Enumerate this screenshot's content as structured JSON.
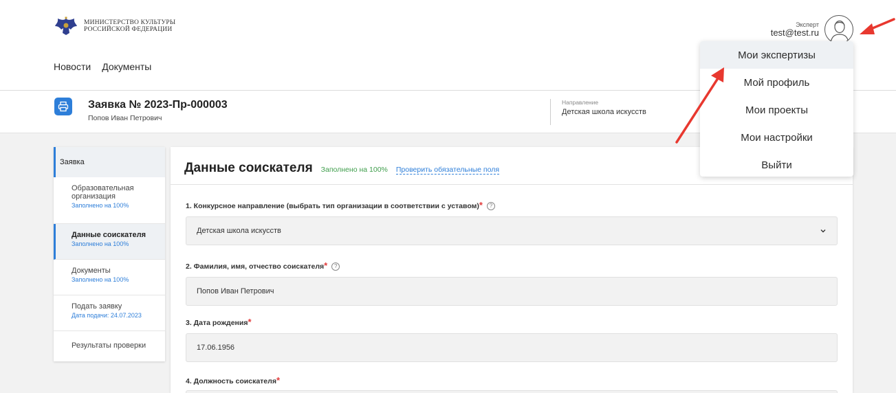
{
  "header": {
    "logo_line1": "МИНИСТЕРСТВО КУЛЬТУРЫ",
    "logo_line2": "РОССИЙСКОЙ ФЕДЕРАЦИИ",
    "nav": [
      "Новости",
      "Документы"
    ],
    "user_role": "Эксперт",
    "user_email": "test@test.ru"
  },
  "appbar": {
    "title": "Заявка № 2023-Пр-000003",
    "subtitle": "Попов Иван Петрович",
    "direction_label": "Направление",
    "direction_value": "Детская школа искусств"
  },
  "sidebar": {
    "head": "Заявка",
    "items": [
      {
        "label": "Образовательная организация",
        "status": "Заполнено на 100%"
      },
      {
        "label": "Данные соискателя",
        "status": "Заполнено на 100%"
      },
      {
        "label": "Документы",
        "status": "Заполнено на 100%"
      },
      {
        "label": "Подать заявку",
        "status": "Дата подачи: 24.07.2023"
      },
      {
        "label": "Результаты проверки",
        "status": ""
      }
    ]
  },
  "form": {
    "title": "Данные соискателя",
    "filled": "Заполнено на 100%",
    "check_link": "Проверить обязательные поля",
    "fields": [
      {
        "label": "1. Конкурсное направление (выбрать тип организации в соответствии с уставом)",
        "value": "Детская школа искусств"
      },
      {
        "label": "2. Фамилия, имя, отчество соискателя",
        "value": "Попов Иван Петрович"
      },
      {
        "label": "3. Дата рождения",
        "value": "17.06.1956"
      },
      {
        "label": "4. Должность соискателя",
        "value": ""
      }
    ],
    "required_mark": "*",
    "help_mark": "?"
  },
  "menu": {
    "items": [
      "Мои экспертизы",
      "Мой профиль",
      "Мои проекты",
      "Мои настройки",
      "Выйти"
    ]
  },
  "colors": {
    "accent": "#2d7ed9",
    "success": "#3e9d4b",
    "required": "#e23b3b",
    "annotation_arrow": "#e8382f"
  }
}
